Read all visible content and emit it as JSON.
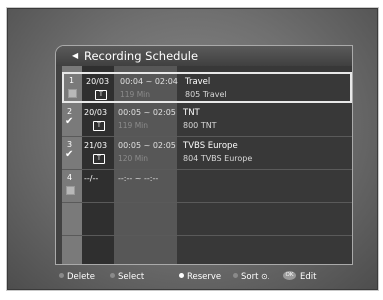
{
  "panel": {
    "title": "Recording Schedule"
  },
  "rows": [
    {
      "num": "1",
      "date": "20/03",
      "time": "00:04 ~ 02:04",
      "duration": "119 Min",
      "channel_name": "Travel",
      "channel_num": "805 Travel",
      "checked": false,
      "selected": true
    },
    {
      "num": "2",
      "date": "20/03",
      "time": "00:05 ~ 02:05",
      "duration": "119 Min",
      "channel_name": "TNT",
      "channel_num": "800 TNT",
      "checked": true,
      "selected": false
    },
    {
      "num": "3",
      "date": "21/03",
      "time": "00:05 ~ 02:05",
      "duration": "120 Min",
      "channel_name": "TVBS Europe",
      "channel_num": "804 TVBS Europe",
      "checked": true,
      "selected": false
    },
    {
      "num": "4",
      "date": "--/--",
      "time": "--:-- ~ --:--",
      "duration": "",
      "channel_name": "",
      "channel_num": "",
      "checked": false,
      "selected": false
    }
  ],
  "legend": {
    "delete": "Delete",
    "select": "Select",
    "reserve": "Reserve",
    "sort": "Sort",
    "ok": "OK",
    "edit": "Edit"
  },
  "colors": {
    "delete_dot": "#8a8a8a",
    "select_dot": "#8a8a8a",
    "reserve_dot": "#ffffff",
    "sort_dot": "#8a8a8a"
  }
}
